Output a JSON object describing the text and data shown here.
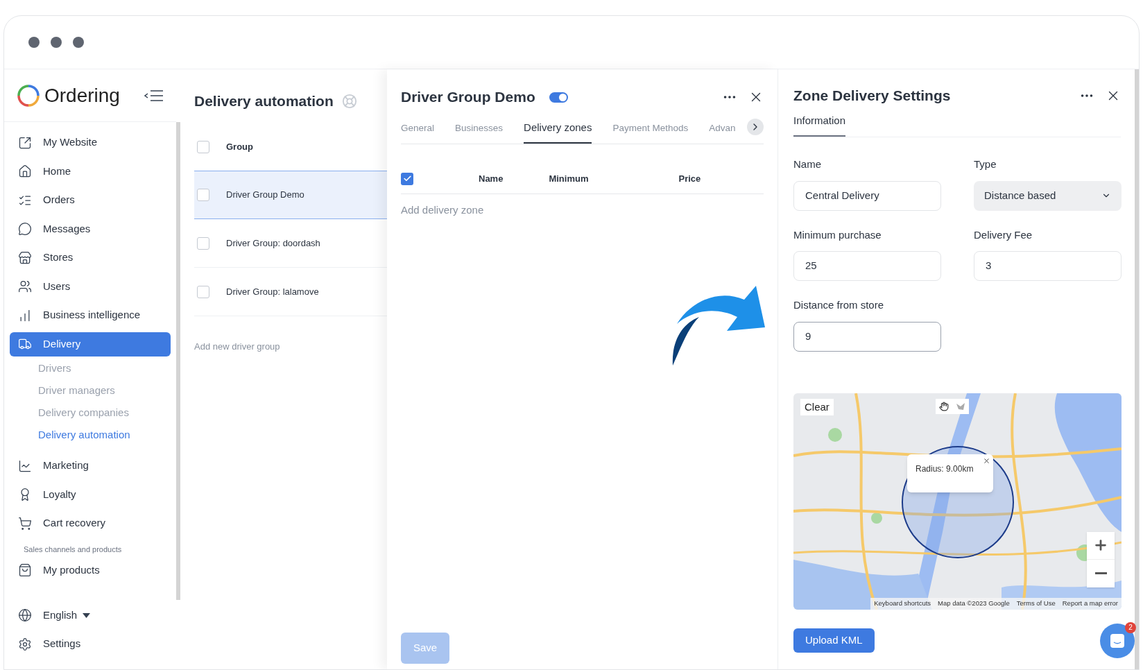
{
  "sidebar": {
    "logo": "Ordering",
    "items": [
      {
        "label": "My Website",
        "selected": false
      },
      {
        "label": "Home",
        "selected": false
      },
      {
        "label": "Orders",
        "selected": false
      },
      {
        "label": "Messages",
        "selected": false
      },
      {
        "label": "Stores",
        "selected": false
      },
      {
        "label": "Users",
        "selected": false
      },
      {
        "label": "Business intelligence",
        "selected": false
      },
      {
        "label": "Delivery",
        "selected": true,
        "children": [
          {
            "label": "Drivers",
            "selected": false
          },
          {
            "label": "Driver managers",
            "selected": false
          },
          {
            "label": "Delivery companies",
            "selected": false
          },
          {
            "label": "Delivery automation",
            "selected": true
          }
        ]
      },
      {
        "label": "Marketing",
        "selected": false
      },
      {
        "label": "Loyalty",
        "selected": false
      },
      {
        "label": "Cart recovery",
        "selected": false
      }
    ],
    "section_label": "Sales channels and products",
    "section_items": [
      {
        "label": "My products",
        "selected": false
      }
    ],
    "footer_items": [
      {
        "label": "English",
        "dropdown": true
      },
      {
        "label": "Settings",
        "dropdown": false
      }
    ]
  },
  "groups_panel": {
    "title": "Delivery automation",
    "column": "Group",
    "all_checked": false,
    "rows": [
      {
        "name": "Driver Group Demo",
        "selected": true
      },
      {
        "name": "Driver Group: doordash",
        "selected": false
      },
      {
        "name": "Driver Group: lalamove",
        "selected": false
      }
    ],
    "add_link": "Add new driver group"
  },
  "driver_group": {
    "title": "Driver Group Demo",
    "enabled": true,
    "tabs": [
      {
        "label": "General",
        "selected": false
      },
      {
        "label": "Businesses",
        "selected": false
      },
      {
        "label": "Delivery zones",
        "selected": true
      },
      {
        "label": "Payment Methods",
        "selected": false
      },
      {
        "label": "Advan",
        "selected": false
      }
    ],
    "table": {
      "all_checked": true,
      "columns": [
        "Name",
        "Minimum",
        "Price"
      ]
    },
    "add_link": "Add delivery zone",
    "save": {
      "label": "Save",
      "disabled": true
    }
  },
  "zone_settings": {
    "title": "Zone Delivery Settings",
    "tabs": [
      {
        "label": "Information",
        "selected": true
      }
    ],
    "fields": [
      {
        "label": "Name",
        "value": "Central Delivery",
        "kind": "input",
        "focused": false
      },
      {
        "label": "Type",
        "value": "Distance based",
        "kind": "select"
      },
      {
        "label": "Minimum purchase",
        "value": "25",
        "kind": "input",
        "focused": false
      },
      {
        "label": "Delivery Fee",
        "value": "3",
        "kind": "input",
        "focused": false
      },
      {
        "label": "Distance from store",
        "value": "9",
        "kind": "input",
        "focused": true
      }
    ],
    "map": {
      "clear": "Clear",
      "popup": "Radius: 9.00km",
      "footer_links": [
        "Keyboard shortcuts",
        "Map data ©2023 Google",
        "Terms of Use",
        "Report a map error"
      ]
    },
    "upload": "Upload KML",
    "chat_badge": "2"
  }
}
